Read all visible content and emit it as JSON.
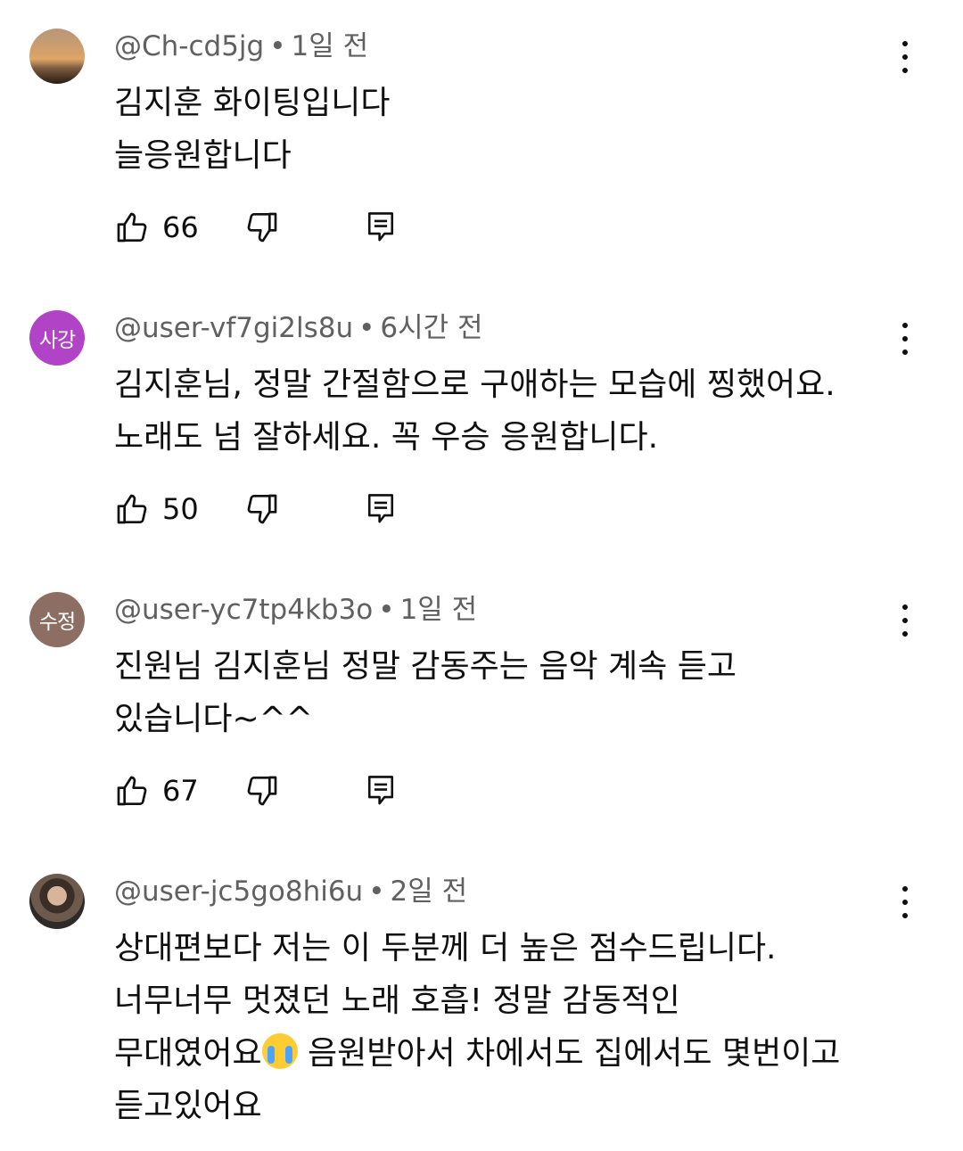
{
  "comments": [
    {
      "avatar_text": "",
      "handle": "@Ch-cd5jg",
      "time": "1일 전",
      "lines": [
        "김지훈 화이팅입니다",
        "늘응원합니다"
      ],
      "likes": "66"
    },
    {
      "avatar_text": "사강",
      "avatar_color": "#b144c6",
      "handle": "@user-vf7gi2ls8u",
      "time": "6시간 전",
      "lines": [
        "김지훈님, 정말 간절함으로 구애하는 모습에 찡했어요.",
        "노래도 넘 잘하세요. 꼭 우승 응원합니다."
      ],
      "likes": "50"
    },
    {
      "avatar_text": "수정",
      "avatar_color": "#8d6e63",
      "handle": "@user-yc7tp4kb3o",
      "time": "1일 전",
      "lines": [
        "진원님 김지훈님 정말 감동주는 음악 계속 듣고",
        "있습니다~^^"
      ],
      "likes": "67"
    },
    {
      "avatar_text": "",
      "handle": "@user-jc5go8hi6u",
      "time": "2일 전",
      "lines": [
        "상대편보다 저는  이 두분께 더 높은 점수드립니다.",
        "너무너무 멋졌던 노래 호흡! 정말 감동적인",
        "무대였어요",
        " 음원받아서 차에서도 집에서도 몇번이고",
        "듣고있어요"
      ]
    }
  ],
  "icons": {
    "like": "thumbs-up-icon",
    "dislike": "thumbs-down-icon",
    "reply": "reply-comment-icon",
    "more": "more-vertical-icon",
    "emoji": "loudly-crying-face-emoji"
  }
}
